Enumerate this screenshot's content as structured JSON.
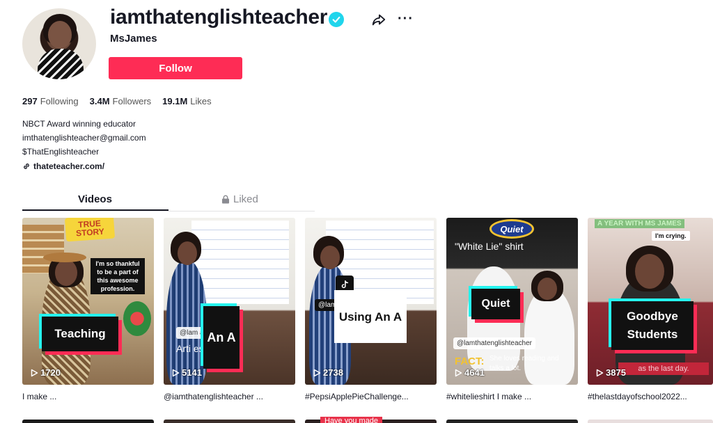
{
  "profile": {
    "username": "iamthatenglishteacher",
    "nickname": "MsJames",
    "follow_label": "Follow",
    "more_label": "···"
  },
  "stats": {
    "following_count": "297",
    "following_label": "Following",
    "followers_count": "3.4M",
    "followers_label": "Followers",
    "likes_count": "19.1M",
    "likes_label": "Likes"
  },
  "bio": {
    "line1": "NBCT Award winning educator",
    "line2": "imthatenglishteacher@gmail.com",
    "line3": "$ThatEnglishteacher",
    "link": "thateteacher.com/"
  },
  "tabs": {
    "videos": "Videos",
    "liked": "Liked"
  },
  "videos": [
    {
      "views": "1720",
      "caption": "I make ...",
      "overlay": "Teaching",
      "sticker": "TRUE STORY",
      "bubble": "I'm so thankful to be a part of this awesome profession."
    },
    {
      "views": "5141",
      "caption": "@iamthatenglishteacher ...",
      "overlay": "An A",
      "handle": "@lam       acher",
      "subtitle": "Arti           es -"
    },
    {
      "views": "2738",
      "caption": "#PepsiApplePieChallenge...",
      "overlay": "Using An A",
      "handle": "@lam"
    },
    {
      "views": "4641",
      "caption": "#whitelieshirt I make ...",
      "overlay": "Quiet",
      "top_text": "\"White Lie\" shirt",
      "logo": "Quiet",
      "handle": "@lamthatenglishteacher",
      "fact": "FACT:",
      "fact_text": "She loves reading and talks a lot."
    },
    {
      "views": "3875",
      "caption": "#thelastdayofschool2022...",
      "overlay": "Goodbye Students",
      "top_banner": "A YEAR WITH MS JAMES",
      "crying": "I'm crying.",
      "bottom_text": "as the last day."
    }
  ],
  "bottom_row": [
    {
      "text": ""
    },
    {
      "text": ""
    },
    {
      "text": "Have you made"
    },
    {
      "text": ""
    },
    {
      "text": ""
    }
  ],
  "colors": {
    "accent": "#fe2c55",
    "cyan": "#25f4ee",
    "verified": "#20d5ec"
  }
}
